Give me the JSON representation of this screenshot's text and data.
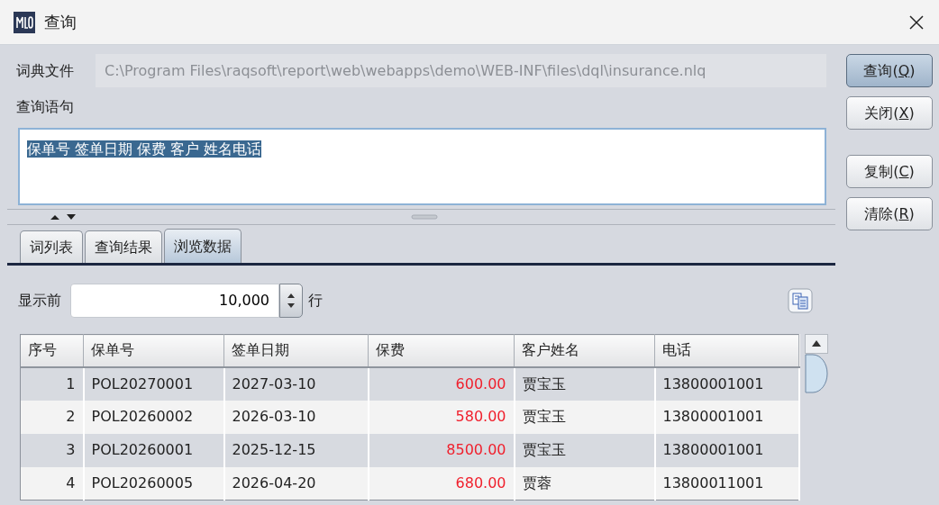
{
  "window": {
    "title": "查询"
  },
  "dictionary": {
    "label": "词典文件",
    "value": "C:\\Program Files\\raqsoft\\report\\web\\webapps\\demo\\WEB-INF\\files\\dql\\insurance.nlq",
    "disabled": true
  },
  "query": {
    "label": "查询语句",
    "value": "保单号 签单日期 保费 客户 姓名电话",
    "highlighted": true
  },
  "buttons": [
    {
      "label": "查询(",
      "mnemonic": "Q",
      "suffix": ")",
      "default": true
    },
    {
      "label": "关闭(",
      "mnemonic": "X",
      "suffix": ")",
      "default": false
    },
    {
      "label": "复制(",
      "mnemonic": "C",
      "suffix": ")",
      "default": false
    },
    {
      "label": "清除(",
      "mnemonic": "R",
      "suffix": ")",
      "default": false
    }
  ],
  "tabs": [
    {
      "label": "词列表",
      "selected": false
    },
    {
      "label": "查询结果",
      "selected": false
    },
    {
      "label": "浏览数据",
      "selected": true
    }
  ],
  "row_limit": {
    "label": "显示前",
    "value": "10,000",
    "unit": "行"
  },
  "table": {
    "columns": [
      {
        "label": "序号",
        "kind": "index"
      },
      {
        "label": "保单号",
        "kind": "text"
      },
      {
        "label": "签单日期",
        "kind": "text"
      },
      {
        "label": "保费",
        "kind": "money"
      },
      {
        "label": "客户姓名",
        "kind": "text"
      },
      {
        "label": "电话",
        "kind": "text"
      }
    ],
    "rows": [
      [
        "1",
        "POL20270001",
        "2027-03-10",
        "600.00",
        "贾宝玉",
        "13800001001"
      ],
      [
        "2",
        "POL20260002",
        "2026-03-10",
        "580.00",
        "贾宝玉",
        "13800001001"
      ],
      [
        "3",
        "POL20260001",
        "2025-12-15",
        "8500.00",
        "贾宝玉",
        "13800001001"
      ],
      [
        "4",
        "POL20260005",
        "2026-04-20",
        "680.00",
        "贾蓉",
        "13800011001"
      ]
    ]
  }
}
